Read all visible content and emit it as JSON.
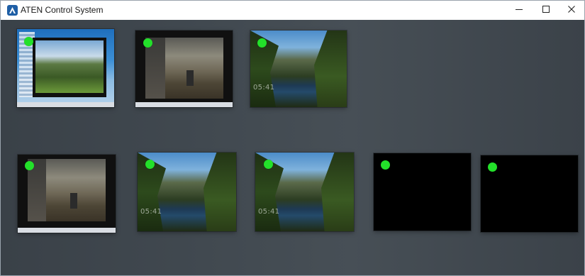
{
  "window": {
    "title": "ATEN Control System",
    "controls": {
      "minimize": "minimize-icon",
      "maximize": "maximize-icon",
      "close": "close-icon"
    }
  },
  "colors": {
    "status_online": "#23e02a",
    "titlebar": "#ffffff",
    "content_background": "#414950",
    "app_icon": "#1f5fa6"
  },
  "thumbnails": [
    {
      "name": "thumb-1",
      "scene": "desktop-with-window",
      "status": "online"
    },
    {
      "name": "thumb-2",
      "scene": "game-window",
      "status": "online"
    },
    {
      "name": "thumb-3",
      "scene": "lock-screen-lake",
      "status": "online",
      "clock": "05:41"
    },
    {
      "name": "thumb-4",
      "scene": "game-window",
      "status": "online"
    },
    {
      "name": "thumb-5",
      "scene": "lock-screen-lake",
      "status": "online",
      "clock": "05:41"
    },
    {
      "name": "thumb-6",
      "scene": "lock-screen-lake",
      "status": "online",
      "clock": "05:41"
    },
    {
      "name": "thumb-7",
      "scene": "black",
      "status": "online"
    },
    {
      "name": "thumb-8",
      "scene": "black",
      "status": "online"
    }
  ]
}
